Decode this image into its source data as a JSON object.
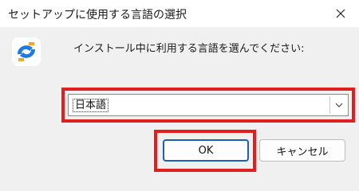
{
  "window": {
    "title": "セットアップに使用する言語の選択"
  },
  "dialog": {
    "message": "インストール中に利用する言語を選んでください:",
    "language_select": {
      "value": "日本語"
    },
    "buttons": {
      "ok": "OK",
      "cancel": "キャンセル"
    }
  },
  "icons": {
    "close": "close-icon",
    "app": "installer-app-icon",
    "dropdown": "chevron-down-icon"
  },
  "colors": {
    "highlight": "#e02020",
    "ok_border": "#1c5fb8",
    "icon_blue": "#1f7be0",
    "icon_orange": "#f5a623"
  }
}
